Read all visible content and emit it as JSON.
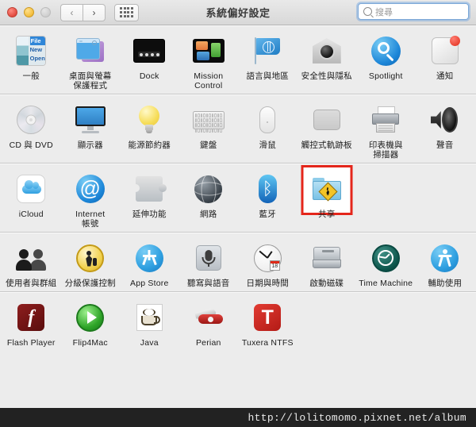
{
  "window": {
    "title": "系統偏好設定",
    "traffic_lights": [
      "close-red",
      "minimize-yellow",
      "zoom-green-disabled"
    ],
    "nav_back": "‹",
    "nav_forward": "›",
    "grid_button": "show-all-grid"
  },
  "search": {
    "placeholder": "搜尋",
    "value": "",
    "icon": "search-icon",
    "focus_ring_color": "#6ea5e1"
  },
  "highlight": {
    "target": "共享",
    "color": "#e4261b"
  },
  "footer": {
    "watermark": "http://lolitomomo.pixnet.net/album",
    "background": "#222222",
    "text_color": "#e8e8e8"
  },
  "rows": [
    {
      "name": "personal-row",
      "items": [
        {
          "label": "一般",
          "icon": "general-icon",
          "icon_key": "general",
          "menu_text": {
            "line1": "File",
            "line2": "New",
            "line3": "Open"
          }
        },
        {
          "label": "桌面與螢幕\n保護程式",
          "icon": "desktop-screensaver-icon",
          "icon_key": "desktop"
        },
        {
          "label": "Dock",
          "icon": "dock-icon",
          "icon_key": "dock"
        },
        {
          "label": "Mission\nControl",
          "icon": "mission-control-icon",
          "icon_key": "mission"
        },
        {
          "label": "語言與地區",
          "icon": "language-region-icon",
          "icon_key": "flag"
        },
        {
          "label": "安全性與隱私",
          "icon": "security-privacy-icon",
          "icon_key": "security"
        },
        {
          "label": "Spotlight",
          "icon": "spotlight-icon",
          "icon_key": "spotlight"
        },
        {
          "label": "通知",
          "icon": "notifications-icon",
          "icon_key": "notifications"
        }
      ]
    },
    {
      "name": "hardware-row",
      "items": [
        {
          "label": "CD 與 DVD",
          "icon": "cd-dvd-icon",
          "icon_key": "cd"
        },
        {
          "label": "顯示器",
          "icon": "displays-icon",
          "icon_key": "display"
        },
        {
          "label": "能源節約器",
          "icon": "energy-saver-icon",
          "icon_key": "bulb"
        },
        {
          "label": "鍵盤",
          "icon": "keyboard-icon",
          "icon_key": "keyboard"
        },
        {
          "label": "滑鼠",
          "icon": "mouse-icon",
          "icon_key": "mouse"
        },
        {
          "label": "觸控式軌跡板",
          "icon": "trackpad-icon",
          "icon_key": "trackpad"
        },
        {
          "label": "印表機與\n掃描器",
          "icon": "printers-scanners-icon",
          "icon_key": "printer"
        },
        {
          "label": "聲音",
          "icon": "sound-icon",
          "icon_key": "speaker"
        }
      ]
    },
    {
      "name": "internet-wireless-row",
      "items": [
        {
          "label": "iCloud",
          "icon": "icloud-icon",
          "icon_key": "icloud"
        },
        {
          "label": "Internet\n帳號",
          "icon": "internet-accounts-icon",
          "icon_key": "at"
        },
        {
          "label": "延伸功能",
          "icon": "extensions-icon",
          "icon_key": "puzzle"
        },
        {
          "label": "網路",
          "icon": "network-icon",
          "icon_key": "network"
        },
        {
          "label": "藍牙",
          "icon": "bluetooth-icon",
          "icon_key": "bluetooth"
        },
        {
          "label": "共享",
          "icon": "sharing-icon",
          "icon_key": "sharing",
          "highlighted": true
        }
      ]
    },
    {
      "name": "system-row",
      "items": [
        {
          "label": "使用者與群組",
          "icon": "users-groups-icon",
          "icon_key": "users"
        },
        {
          "label": "分級保護控制",
          "icon": "parental-controls-icon",
          "icon_key": "parental"
        },
        {
          "label": "App Store",
          "icon": "app-store-icon",
          "icon_key": "appstore"
        },
        {
          "label": "聽寫與語音",
          "icon": "dictation-speech-icon",
          "icon_key": "mic"
        },
        {
          "label": "日期與時間",
          "icon": "date-time-icon",
          "icon_key": "clock",
          "day": "18"
        },
        {
          "label": "啟動磁碟",
          "icon": "startup-disk-icon",
          "icon_key": "harddisk"
        },
        {
          "label": "Time Machine",
          "icon": "time-machine-icon",
          "icon_key": "timemachine"
        },
        {
          "label": "輔助使用",
          "icon": "accessibility-icon",
          "icon_key": "accessibility"
        }
      ]
    },
    {
      "name": "other-row",
      "items": [
        {
          "label": "Flash Player",
          "icon": "flash-player-icon",
          "icon_key": "flash",
          "glyph": "f"
        },
        {
          "label": "Flip4Mac",
          "icon": "flip4mac-icon",
          "icon_key": "flip"
        },
        {
          "label": "Java",
          "icon": "java-icon",
          "icon_key": "java"
        },
        {
          "label": "Perian",
          "icon": "perian-icon",
          "icon_key": "perian"
        },
        {
          "label": "Tuxera NTFS",
          "icon": "tuxera-ntfs-icon",
          "icon_key": "tuxera",
          "glyph": "T"
        }
      ]
    }
  ]
}
